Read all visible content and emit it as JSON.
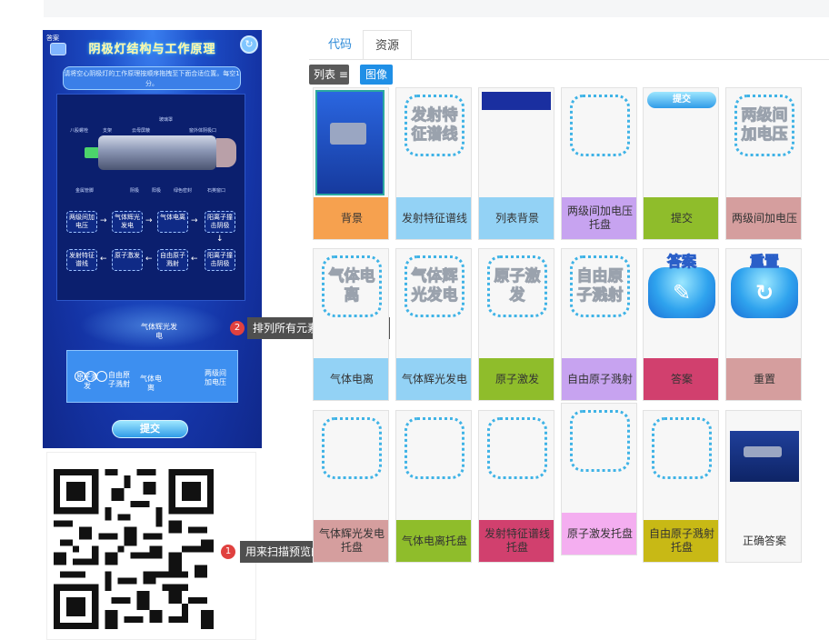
{
  "preview": {
    "title": "阴极灯结构与工作原理",
    "prompt": "请将空心阴极灯的工作原理按顺序拖拽至下面合适位置。每空1分。",
    "left_corner_label": "答案",
    "panel_labels": [
      "八股螺栓",
      "支架",
      "云母屏蔽",
      "玻璃罩",
      "窗外体阴极口",
      "金属管脚",
      "阴极",
      "阳极",
      "绿色密封",
      "石英窗口"
    ],
    "flow_nodes": [
      "两级间加电压",
      "气体辉光发电",
      "气体电离",
      "阳离子撞击阴极",
      "发射特征谱线",
      "原子激发",
      "自由原子溅射",
      "阳离子撞击阴极"
    ],
    "floating_piece": "气体辉光发电",
    "tray_pieces": [
      "原子激发",
      "自由原子溅射",
      "气体电离",
      "两级间加电压"
    ],
    "submit_label": "提交"
  },
  "tooltips": {
    "preview_tip": {
      "index": "2",
      "text": "排列所有元素的初步预览图"
    },
    "qr_tip": {
      "index": "1",
      "text": "用来扫描预览的二维码"
    }
  },
  "tabs": {
    "code": "代码",
    "resources": "资源"
  },
  "toolbar": {
    "list_label": "列表",
    "list_icon": "≡",
    "image_label": "图像"
  },
  "resources": [
    {
      "label": "背景",
      "thumb": "screenshot",
      "color": "#f6a14f"
    },
    {
      "label": "发射特征谱线",
      "thumb_text": "发射特征谱线",
      "color": "#93d2f5"
    },
    {
      "label": "列表背景",
      "thumb": "bar",
      "color": "#93d2f5"
    },
    {
      "label": "两级间加电压托盘",
      "thumb_text": "",
      "color": "#c7a3f0"
    },
    {
      "label": "提交",
      "thumb": "pill",
      "thumb_text": "提交",
      "color": "#8fbd2b"
    },
    {
      "label": "两级间加电压",
      "thumb_text": "两级间加电压",
      "color": "#d59e9e"
    },
    {
      "label": "气体电离",
      "thumb_text": "气体电离",
      "color": "#93d2f5"
    },
    {
      "label": "气体辉光发电",
      "thumb_text": "气体辉光发电",
      "color": "#93d2f5"
    },
    {
      "label": "原子激发",
      "thumb_text": "原子激发",
      "color": "#8fbd2b"
    },
    {
      "label": "自由原子溅射",
      "thumb_text": "自由原子溅射",
      "color": "#c7a3f0"
    },
    {
      "label": "答案",
      "thumb": "answer",
      "thumb_text": "答案",
      "color": "#d1406e"
    },
    {
      "label": "重置",
      "thumb": "reset",
      "thumb_text": "重置",
      "color": "#d59e9e"
    },
    {
      "label": "气体辉光发电托盘",
      "thumb_text": "",
      "color": "#d59e9e"
    },
    {
      "label": "气体电离托盘",
      "thumb_text": "",
      "color": "#8fbd2b"
    },
    {
      "label": "发射特征谱线托盘",
      "thumb_text": "",
      "color": "#d1406e"
    },
    {
      "label": "原子激发托盘",
      "thumb_text": "",
      "color": "#f4aef0"
    },
    {
      "label": "自由原子溅射托盘",
      "thumb_text": "",
      "color": "#c8b915"
    },
    {
      "label": "正确答案",
      "thumb": "screenshot2",
      "color": "#f7f7f7"
    }
  ]
}
